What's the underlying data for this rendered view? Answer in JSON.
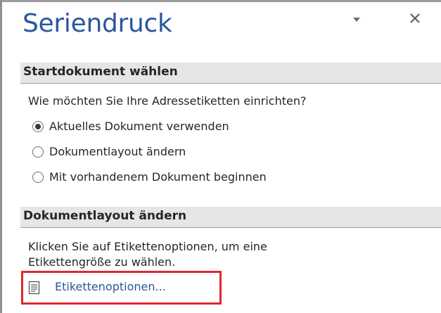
{
  "pane": {
    "title": "Seriendruck",
    "menu_icon": "dropdown-triangle-icon",
    "close_icon": "close-icon"
  },
  "section_start": {
    "header": "Startdokument wählen",
    "question": "Wie möchten Sie Ihre Adressetiketten einrichten?",
    "options": [
      {
        "label": "Aktuelles Dokument verwenden",
        "selected": true
      },
      {
        "label": "Dokumentlayout ändern",
        "selected": false
      },
      {
        "label": "Mit vorhandenem Dokument beginnen",
        "selected": false
      }
    ]
  },
  "section_layout": {
    "header": "Dokumentlayout ändern",
    "description_line1": "Klicken Sie auf Etikettenoptionen, um eine",
    "description_line2": "Etikettengröße zu wählen.",
    "link_label": "Etikettenoptionen...",
    "link_icon": "document-page-icon"
  },
  "colors": {
    "title_blue": "#2b579a",
    "link_blue": "#2b579a",
    "section_header_bg": "#e6e6e6",
    "highlight_red": "#e0282e"
  }
}
